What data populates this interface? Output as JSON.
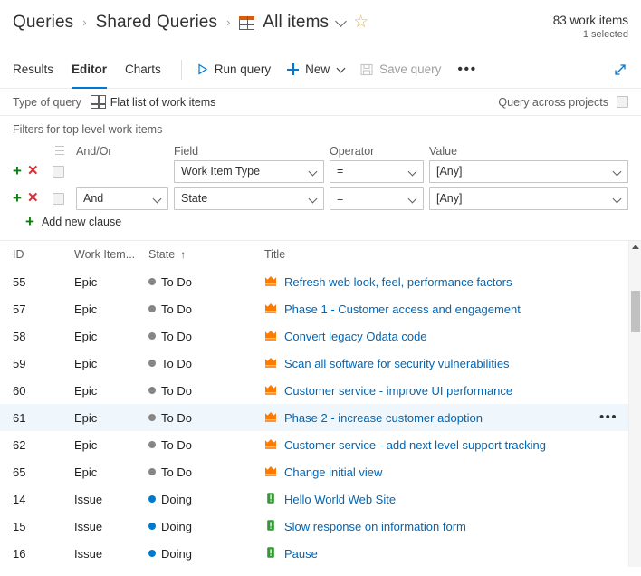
{
  "header": {
    "breadcrumb": [
      {
        "label": "Queries",
        "type": "link"
      },
      {
        "label": "Shared Queries",
        "type": "link"
      },
      {
        "label": "All items",
        "type": "current"
      }
    ],
    "separator": "›",
    "grid_icon": "grid-icon",
    "chevron_icon": "chevron-down-icon",
    "favorite_icon": "star-icon",
    "favorite_glyph": "☆",
    "work_items_count": "83 work items",
    "selected_count": "1 selected"
  },
  "toolbar": {
    "tabs": [
      {
        "label": "Results",
        "active": false
      },
      {
        "label": "Editor",
        "active": true
      },
      {
        "label": "Charts",
        "active": false
      }
    ],
    "run_query_label": "Run query",
    "run_query_icon": "play-icon",
    "new_label": "New",
    "new_icon": "plus-icon",
    "new_chevron_icon": "chevron-down-icon",
    "save_query_label": "Save query",
    "save_query_icon": "save-icon",
    "save_query_disabled": true,
    "overflow_label": "•••",
    "overflow_icon": "more-icon",
    "expand_icon": "full-screen-icon"
  },
  "query_type": {
    "label": "Type of query",
    "value": "Flat list of work items",
    "value_icon": "grid-icon",
    "across_projects_label": "Query across projects",
    "across_projects_checked": false
  },
  "filters": {
    "title": "Filters for top level work items",
    "group_icon": "group-clauses-icon",
    "columns": {
      "and_or": "And/Or",
      "field": "Field",
      "operator": "Operator",
      "value": "Value"
    },
    "add_icon": "add-clause-icon",
    "delete_icon": "delete-clause-icon",
    "rows": [
      {
        "and_or": "",
        "field": "Work Item Type",
        "operator": "=",
        "value": "[Any]",
        "checked": false
      },
      {
        "and_or": "And",
        "field": "State",
        "operator": "=",
        "value": "[Any]",
        "checked": false
      }
    ],
    "add_new_clause_label": "Add new clause"
  },
  "results": {
    "columns": {
      "id": "ID",
      "work_item_type": "Work Item...",
      "state": "State",
      "state_sort_glyph": "↑",
      "title": "Title"
    },
    "rows": [
      {
        "id": "55",
        "type": "Epic",
        "state": "To Do",
        "state_color": "#868686",
        "icon": "epic-icon",
        "title": "Refresh web look, feel, performance factors",
        "selected": false
      },
      {
        "id": "57",
        "type": "Epic",
        "state": "To Do",
        "state_color": "#868686",
        "icon": "epic-icon",
        "title": "Phase 1 - Customer access and engagement",
        "selected": false
      },
      {
        "id": "58",
        "type": "Epic",
        "state": "To Do",
        "state_color": "#868686",
        "icon": "epic-icon",
        "title": "Convert legacy Odata code",
        "selected": false
      },
      {
        "id": "59",
        "type": "Epic",
        "state": "To Do",
        "state_color": "#868686",
        "icon": "epic-icon",
        "title": "Scan all software for security vulnerabilities",
        "selected": false
      },
      {
        "id": "60",
        "type": "Epic",
        "state": "To Do",
        "state_color": "#868686",
        "icon": "epic-icon",
        "title": "Customer service - improve UI performance",
        "selected": false
      },
      {
        "id": "61",
        "type": "Epic",
        "state": "To Do",
        "state_color": "#868686",
        "icon": "epic-icon",
        "title": "Phase 2 - increase customer adoption",
        "selected": true
      },
      {
        "id": "62",
        "type": "Epic",
        "state": "To Do",
        "state_color": "#868686",
        "icon": "epic-icon",
        "title": "Customer service - add next level support tracking",
        "selected": false
      },
      {
        "id": "65",
        "type": "Epic",
        "state": "To Do",
        "state_color": "#868686",
        "icon": "epic-icon",
        "title": "Change initial view",
        "selected": false
      },
      {
        "id": "14",
        "type": "Issue",
        "state": "Doing",
        "state_color": "#007acc",
        "icon": "issue-icon",
        "title": "Hello World Web Site",
        "selected": false
      },
      {
        "id": "15",
        "type": "Issue",
        "state": "Doing",
        "state_color": "#007acc",
        "icon": "issue-icon",
        "title": "Slow response on information form",
        "selected": false
      },
      {
        "id": "16",
        "type": "Issue",
        "state": "Doing",
        "state_color": "#007acc",
        "icon": "issue-icon",
        "title": "Pause",
        "selected": false
      }
    ],
    "row_menu_label": "•••",
    "row_menu_icon": "more-icon",
    "scrollbar_up_icon": "scroll-up-icon"
  },
  "colors": {
    "accent": "#0078d4",
    "link": "#0066b5",
    "epic_icon": "#ff7b00",
    "issue_icon": "#339933",
    "selected_row": "#eff6fc",
    "add_green": "#107c10",
    "delete_red": "#d13438",
    "star_gold": "#f2b441"
  }
}
